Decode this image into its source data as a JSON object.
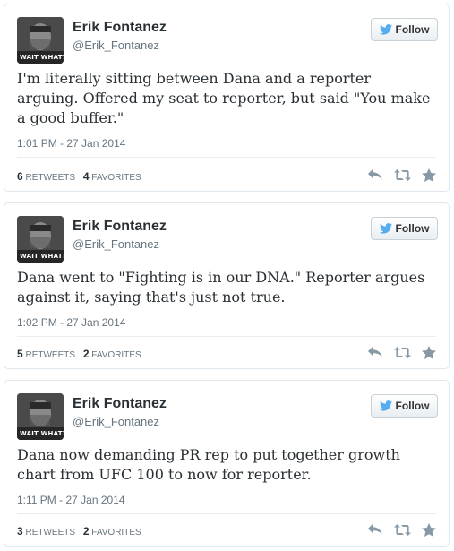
{
  "tweets": [
    {
      "name": "Erik Fontanez",
      "handle": "@Erik_Fontanez",
      "follow_label": "Follow",
      "avatar_stamp": "WAIT WHAT?",
      "text": "I'm literally sitting between Dana and a reporter arguing. Offered my seat to reporter, but said \"You make a good buffer.\"",
      "timestamp": "1:01 PM - 27 Jan 2014",
      "retweets": "6",
      "retweets_label": "RETWEETS",
      "favorites": "4",
      "favorites_label": "FAVORITES"
    },
    {
      "name": "Erik Fontanez",
      "handle": "@Erik_Fontanez",
      "follow_label": "Follow",
      "avatar_stamp": "WAIT WHAT?",
      "text": "Dana went to \"Fighting is in our DNA.\" Reporter argues against it, saying that's just not true.",
      "timestamp": "1:02 PM - 27 Jan 2014",
      "retweets": "5",
      "retweets_label": "RETWEETS",
      "favorites": "2",
      "favorites_label": "FAVORITES"
    },
    {
      "name": "Erik Fontanez",
      "handle": "@Erik_Fontanez",
      "follow_label": "Follow",
      "avatar_stamp": "WAIT WHAT?",
      "text": "Dana now demanding PR rep to put together growth chart from UFC 100 to now for reporter.",
      "timestamp": "1:11 PM - 27 Jan 2014",
      "retweets": "3",
      "retweets_label": "RETWEETS",
      "favorites": "2",
      "favorites_label": "FAVORITES"
    }
  ],
  "icons": {
    "follow": "twitter-bird-icon",
    "reply": "reply-icon",
    "retweet": "retweet-icon",
    "favorite": "star-icon"
  },
  "colors": {
    "twitter_blue": "#55acee",
    "action_gray": "#8899a6",
    "border": "#e1e8ed"
  }
}
